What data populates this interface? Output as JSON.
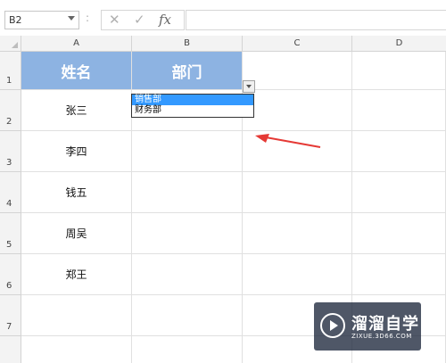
{
  "formula_bar": {
    "name_box": "B2",
    "separator": ":",
    "cancel_icon": "✕",
    "confirm_icon": "✓",
    "fx_label": "fx",
    "formula_value": ""
  },
  "columns": [
    "A",
    "B",
    "C",
    "D"
  ],
  "rows": [
    "1",
    "2",
    "3",
    "4",
    "5",
    "6",
    "7"
  ],
  "header_row": {
    "col_a": "姓名",
    "col_b": "部门",
    "fill_color": "#8db3e2"
  },
  "names": [
    "张三",
    "李四",
    "钱五",
    "周吴",
    "郑王"
  ],
  "dropdown": {
    "options": [
      "销售部",
      "财务部"
    ],
    "selected": "销售部",
    "highlight_color": "#3399ff"
  },
  "annotation": {
    "arrow_color": "#e53935"
  },
  "watermark": {
    "brand": "溜溜自学",
    "url": "ZIXUE.3D66.COM"
  }
}
